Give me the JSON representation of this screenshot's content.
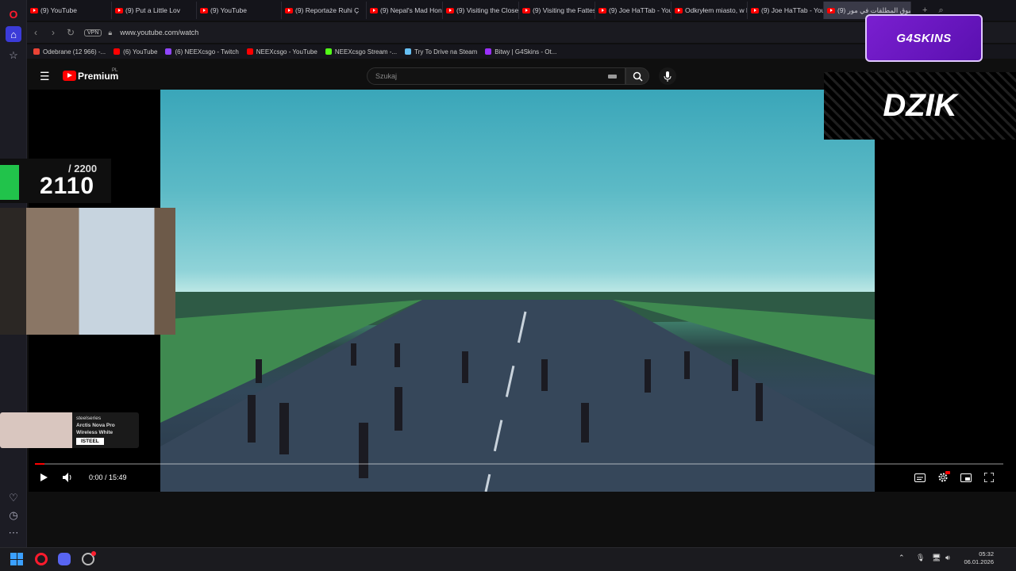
{
  "browser": {
    "tabs": [
      {
        "label": "(9) YouTube"
      },
      {
        "label": "(9) Put a Little Lov"
      },
      {
        "label": "(9) YouTube"
      },
      {
        "label": "(9) Reportaże Ruhi Ç"
      },
      {
        "label": "(9) Nepal's Mad Hone"
      },
      {
        "label": "(9) Visiting the Closes"
      },
      {
        "label": "(9) Visiting the Fattest"
      },
      {
        "label": "(9) Joe HaTTab - YouT"
      },
      {
        "label": "Odkryłem miasto, w k"
      },
      {
        "label": "(9) Joe HaTTab - YouT"
      },
      {
        "label": "(9) سوق المطلقات في مور"
      }
    ],
    "address": {
      "vpn_label": "VPN",
      "url": "www.youtube.com/watch"
    },
    "bookmarks": [
      {
        "label": "Odebrane (12 966) -...",
        "color": "#ea4335"
      },
      {
        "label": "(6) YouTube",
        "color": "#ff0000"
      },
      {
        "label": "(6) NEEXcsgo - Twitch",
        "color": "#9146ff"
      },
      {
        "label": "NEEXcsgo - YouTube",
        "color": "#ff0000"
      },
      {
        "label": "NEEXcsgo Stream -...",
        "color": "#53fc18"
      },
      {
        "label": "Try To Drive na Steam",
        "color": "#66c0f4"
      },
      {
        "label": "Bitwy | G4Skins - Ot...",
        "color": "#9b30ff"
      }
    ]
  },
  "youtube": {
    "logo_label": "Premium",
    "region": "PL",
    "search_placeholder": "Szukaj"
  },
  "overlays": {
    "g4skins_label": "G4SKINS",
    "dzik_label": "DZIK",
    "score_max": "/ 2200",
    "score_current": "2110",
    "steelseries_brand": "steelseries",
    "steelseries_product": "Arctis Nova Pro Wireless White",
    "steelseries_code": "ISTEEL"
  },
  "player": {
    "time": "0:00 / 15:49",
    "progress_fraction": 0.01
  },
  "taskbar": {
    "time": "05:32",
    "date": "06.01.2026"
  }
}
